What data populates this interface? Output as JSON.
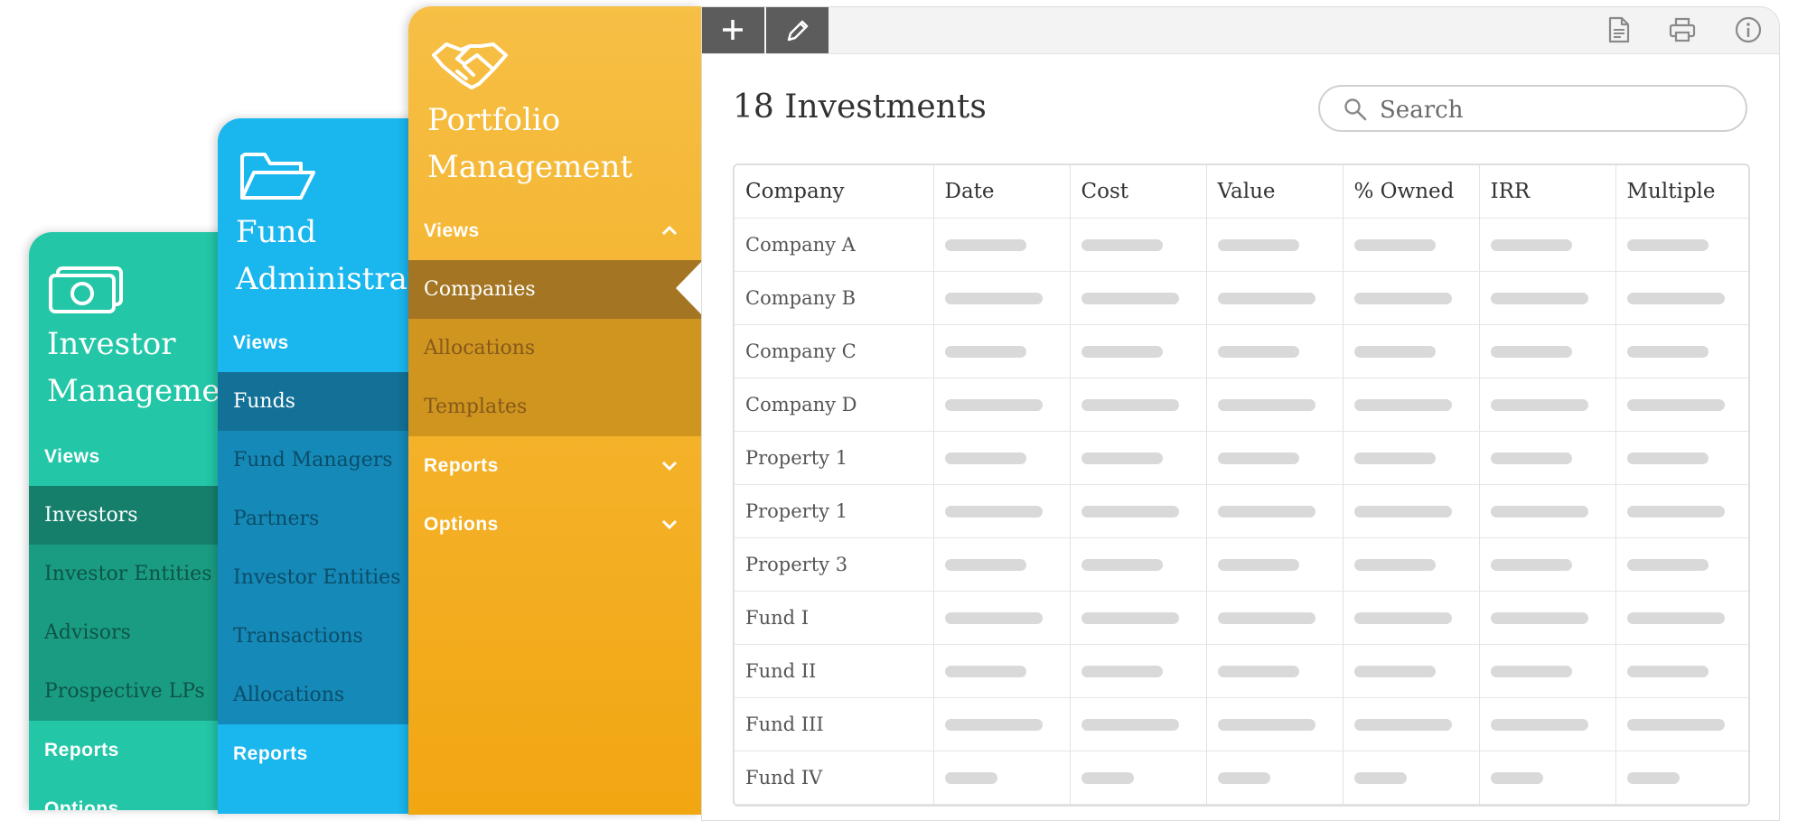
{
  "investor_panel": {
    "title_line1": "Investor",
    "title_line2": "Management",
    "views_label": "Views",
    "items": [
      "Investors",
      "Investor Entities",
      "Advisors",
      "Prospective LPs"
    ],
    "reports_label": "Reports",
    "options_label": "Options",
    "icon": "money-icon"
  },
  "fund_panel": {
    "title_line1": "Fund",
    "title_line2": "Administration",
    "views_label": "Views",
    "items": [
      "Funds",
      "Fund Managers",
      "Partners",
      "Investor Entities",
      "Transactions",
      "Allocations"
    ],
    "reports_label": "Reports",
    "icon": "folder-icon"
  },
  "portfolio_panel": {
    "title_line1": "Portfolio",
    "title_line2": "Management",
    "views_label": "Views",
    "items": [
      "Companies",
      "Allocations",
      "Templates"
    ],
    "reports_label": "Reports",
    "options_label": "Options",
    "icon": "handshake-icon"
  },
  "toolbar": {
    "add_icon": "plus-icon",
    "edit_icon": "pencil-icon",
    "right_icons": [
      "document-icon",
      "print-icon",
      "info-icon"
    ]
  },
  "main": {
    "heading": "18 Investments",
    "search_placeholder": "Search"
  },
  "table": {
    "columns": [
      "Company",
      "Date",
      "Cost",
      "Value",
      "% Owned",
      "IRR",
      "Multiple"
    ],
    "rows": [
      "Company A",
      "Company B",
      "Company C",
      "Company D",
      "Property 1",
      "Property 1",
      "Property 3",
      "Fund I",
      "Fund II",
      "Fund III",
      "Fund IV"
    ]
  },
  "colors": {
    "teal": "#23c6a7",
    "blue": "#1ab6ee",
    "orange": "#f2a612",
    "toolbar_button": "#5c5c5c"
  }
}
